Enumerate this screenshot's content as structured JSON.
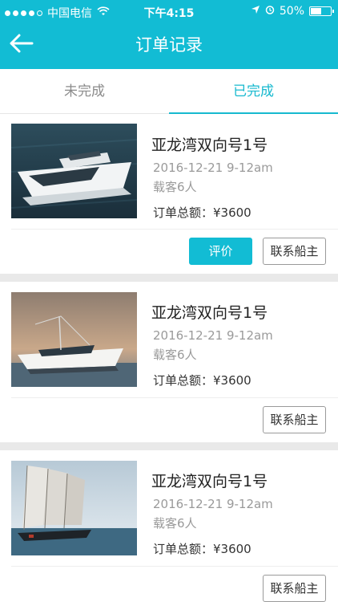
{
  "status_bar": {
    "carrier": "中国电信",
    "time": "下午4:15",
    "battery": "50%",
    "battery_level": 0.5
  },
  "header": {
    "title": "订单记录",
    "back_icon": "arrow-left-icon"
  },
  "tabs": [
    {
      "label": "未完成",
      "active": false
    },
    {
      "label": "已完成",
      "active": true
    }
  ],
  "orders": [
    {
      "name": "亚龙湾双向号1号",
      "datetime": "2016-12-21   9-12am",
      "passengers": "载客6人",
      "total": "订单总额：¥3600",
      "buttons": {
        "review": "评价",
        "contact": "联系船主"
      }
    },
    {
      "name": "亚龙湾双向号1号",
      "datetime": "2016-12-21   9-12am",
      "passengers": "载客6人",
      "total": "订单总额：¥3600",
      "buttons": {
        "contact": "联系船主"
      }
    },
    {
      "name": "亚龙湾双向号1号",
      "datetime": "2016-12-21   9-12am",
      "passengers": "载客6人",
      "total": "订单总额：¥3600",
      "buttons": {
        "contact": "联系船主"
      }
    }
  ]
}
